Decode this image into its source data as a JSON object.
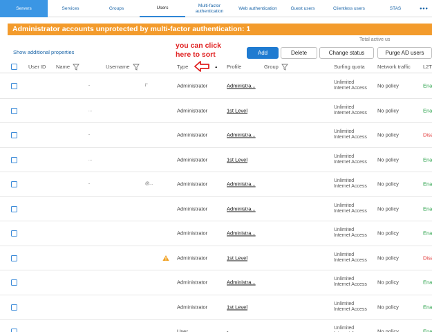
{
  "tabs": [
    {
      "label": "Servers",
      "state": "active"
    },
    {
      "label": "Services",
      "state": "normal"
    },
    {
      "label": "Groups",
      "state": "normal"
    },
    {
      "label": "Users",
      "state": "selected"
    },
    {
      "label": "Multi-factor\nauthentication",
      "state": "normal"
    },
    {
      "label": "Web authentication",
      "state": "normal"
    },
    {
      "label": "Guest users",
      "state": "normal"
    },
    {
      "label": "Clientless users",
      "state": "normal"
    },
    {
      "label": "STAS",
      "state": "normal"
    },
    {
      "label": "•••",
      "state": "more"
    }
  ],
  "banner": {
    "text": "Administrator accounts unprotected by multi-factor authentication: 1",
    "color": "#f39b2c"
  },
  "total_active_label": "Total active us",
  "show_props_label": "Show additional properties",
  "toolbar": {
    "add_label": "Add",
    "delete_label": "Delete",
    "change_status_label": "Change status",
    "purge_label": "Purge AD users"
  },
  "annotation": {
    "line1": "you can click",
    "line2": "here to sort",
    "color": "#e02020"
  },
  "columns": {
    "user_id": "User ID",
    "name": "Name",
    "username": "Username",
    "type": "Type",
    "profile": "Profile",
    "group": "Group",
    "quota": "Surfing quota",
    "network": "Network traffic",
    "l2t": "L2T"
  },
  "rows": [
    {
      "name": "-",
      "username": "i\"",
      "type": "Administrator",
      "profile": "Administra...",
      "quota": "Unlimited Internet Access",
      "network": "No policy",
      "status": "Ena",
      "status_kind": "en",
      "warn": false
    },
    {
      "name": "...",
      "username": "",
      "type": "Administrator",
      "profile": "1st Level",
      "quota": "Unlimited Internet Access",
      "network": "No policy",
      "status": "Ena",
      "status_kind": "en",
      "warn": false
    },
    {
      "name": "-",
      "username": "",
      "type": "Administrator",
      "profile": "Administra...",
      "quota": "Unlimited Internet Access",
      "network": "No policy",
      "status": "Disa",
      "status_kind": "dis",
      "warn": false
    },
    {
      "name": "...",
      "username": "",
      "type": "Administrator",
      "profile": "1st Level",
      "quota": "Unlimited Internet Access",
      "network": "No policy",
      "status": "Ena",
      "status_kind": "en",
      "warn": false
    },
    {
      "name": "-",
      "username": "@...",
      "type": "Administrator",
      "profile": "Administra...",
      "quota": "Unlimited Internet Access",
      "network": "No policy",
      "status": "Ena",
      "status_kind": "en",
      "warn": false
    },
    {
      "name": "",
      "username": "",
      "type": "Administrator",
      "profile": "Administra...",
      "quota": "Unlimited Internet Access",
      "network": "No policy",
      "status": "Ena",
      "status_kind": "en",
      "warn": false
    },
    {
      "name": "",
      "username": "",
      "type": "Administrator",
      "profile": "Administra...",
      "quota": "Unlimited Internet Access",
      "network": "No policy",
      "status": "Ena",
      "status_kind": "en",
      "warn": false
    },
    {
      "name": "",
      "username": "",
      "type": "Administrator",
      "profile": "1st Level",
      "quota": "Unlimited Internet Access",
      "network": "No policy",
      "status": "Disa",
      "status_kind": "dis",
      "warn": true
    },
    {
      "name": "",
      "username": "",
      "type": "Administrator",
      "profile": "Administra...",
      "quota": "Unlimited Internet Access",
      "network": "No policy",
      "status": "Ena",
      "status_kind": "en",
      "warn": false
    },
    {
      "name": "",
      "username": "",
      "type": "Administrator",
      "profile": "1st Level",
      "quota": "Unlimited Internet Access",
      "network": "No policy",
      "status": "Ena",
      "status_kind": "en",
      "warn": false
    },
    {
      "name": "",
      "username": "",
      "type": "User",
      "profile": "-",
      "quota": "Unlimited Internet Access",
      "network": "No policy",
      "status": "Ena",
      "status_kind": "en",
      "warn": false
    }
  ],
  "icons": {
    "filter": "filter-icon",
    "warning": "warning-icon",
    "sort": "sort-asc-icon",
    "arrow": "left-arrow-annotation"
  }
}
